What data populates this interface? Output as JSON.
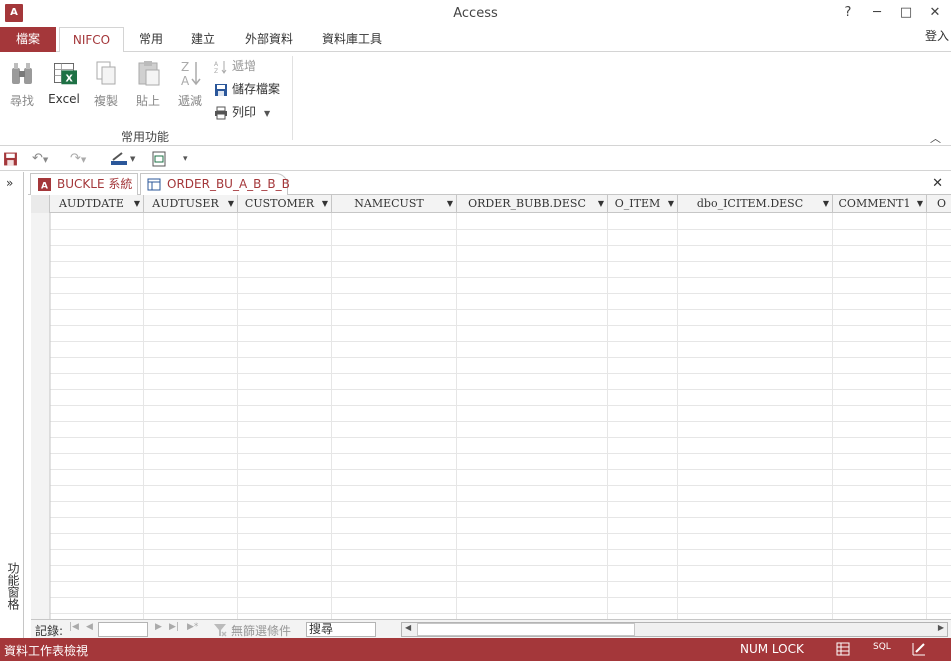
{
  "title": "Access",
  "logo_text": "A",
  "window_controls": {
    "help": "?",
    "minimize": "─",
    "maximize": "□",
    "close": "✕"
  },
  "ribbon_tabs": [
    "檔案",
    "NIFCO",
    "常用",
    "建立",
    "外部資料",
    "資料庫工具"
  ],
  "signin": "登入",
  "ribbon": {
    "find": "尋找",
    "excel": "Excel",
    "copy": "複製",
    "paste": "貼上",
    "descending": "遞減",
    "ascending": "遞增",
    "save_file": "儲存檔案",
    "print": "列印",
    "group": "常用功能"
  },
  "nav_pane": {
    "toggle": "»",
    "label": "功能窗格"
  },
  "doc_tabs": [
    {
      "label": "BUCKLE 系統"
    },
    {
      "label": "ORDER_BU_A_B_B_B"
    }
  ],
  "doc_close": "✕",
  "columns": [
    "AUDTDATE",
    "AUDTUSER",
    "CUSTOMER",
    "NAMECUST",
    "ORDER_BUBB.DESC",
    "O_ITEM",
    "dbo_ICITEM.DESC",
    "COMMENT1",
    "O"
  ],
  "record_nav": {
    "label": "記錄:",
    "filter": "無篩選條件",
    "search": "搜尋"
  },
  "status": {
    "view": "資料工作表檢視",
    "numlock": "NUM LOCK",
    "sql": "SQL"
  },
  "colors": {
    "accent": "#a4373a"
  }
}
